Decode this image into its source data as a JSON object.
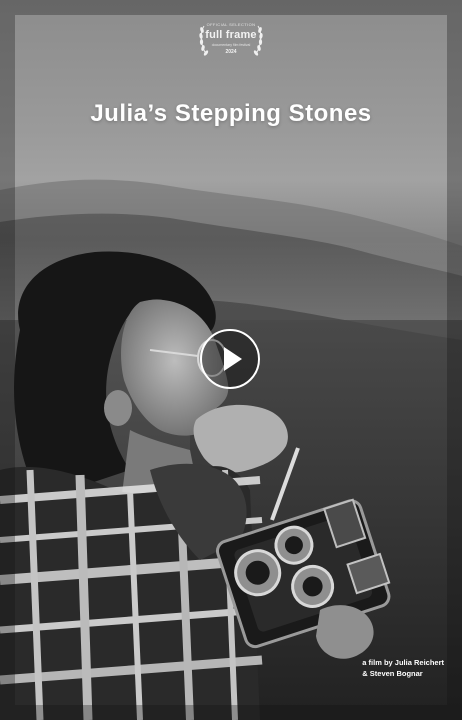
{
  "poster": {
    "laurel": {
      "selection": "OFFICIAL SELECTION",
      "festival": "full frame",
      "subtitle": "documentary film festival",
      "year": "2024"
    },
    "title": "Julia’s Stepping Stones",
    "credits": {
      "line1": "a film by Julia Reichert",
      "line2": "& Steven Bognar"
    }
  },
  "player": {
    "play_icon": "play-icon"
  },
  "colors": {
    "title": "#ffffff",
    "play_ring": "#ffffff"
  }
}
